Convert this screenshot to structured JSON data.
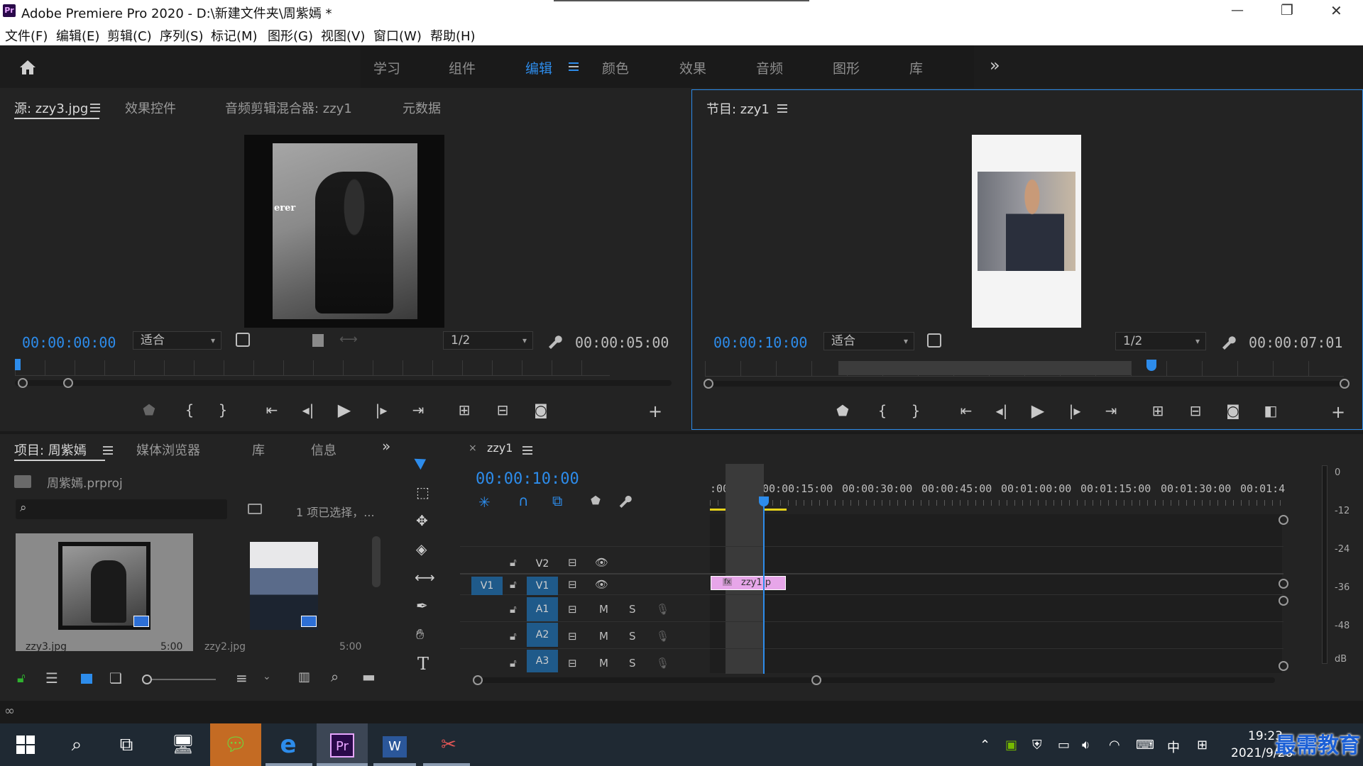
{
  "titlebar": {
    "app_icon": "Pr",
    "title": "Adobe Premiere Pro 2020 - D:\\新建文件夹\\周紫嫣 *",
    "minimize": "—",
    "maximize": "❐",
    "close": "✕"
  },
  "menu": [
    "文件(F)",
    "编辑(E)",
    "剪辑(C)",
    "序列(S)",
    "标记(M)",
    "图形(G)",
    "视图(V)",
    "窗口(W)",
    "帮助(H)"
  ],
  "workspace": {
    "tabs": [
      "学习",
      "组件",
      "编辑",
      "颜色",
      "效果",
      "音频",
      "图形",
      "库"
    ],
    "active": "编辑",
    "more": "»"
  },
  "source_panel": {
    "tabs": [
      "源: zzy3.jpg",
      "效果控件",
      "音频剪辑混合器: zzy1",
      "元数据"
    ],
    "timecode_left": "00:00:00:00",
    "fit": "适合",
    "resolution": "1/2",
    "timecode_right": "00:00:05:00",
    "image_text": "erer"
  },
  "program_panel": {
    "title": "节目: zzy1",
    "timecode_left": "00:00:10:00",
    "fit": "适合",
    "resolution": "1/2",
    "timecode_right": "00:00:07:01"
  },
  "project_panel": {
    "tabs": [
      "项目: 周紫嫣",
      "媒体浏览器",
      "库",
      "信息"
    ],
    "project_file": "周紫嫣.prproj",
    "selection_info": "1 项已选择，...",
    "items": [
      {
        "name": "zzy3.jpg",
        "duration": "5:00"
      },
      {
        "name": "zzy2.jpg",
        "duration": "5:00"
      }
    ]
  },
  "timeline": {
    "sequence": "zzy1",
    "timecode": "00:00:10:00",
    "ruler": [
      ":00:00",
      "00:00:15:00",
      "00:00:30:00",
      "00:00:45:00",
      "00:01:00:00",
      "00:01:15:00",
      "00:01:30:00",
      "00:01:4"
    ],
    "tracks": [
      {
        "label": "V2",
        "source": ""
      },
      {
        "label": "V1",
        "source": "V1"
      },
      {
        "label": "A1",
        "source": ""
      },
      {
        "label": "A2",
        "source": ""
      },
      {
        "label": "A3",
        "source": ""
      }
    ],
    "mute": "M",
    "solo": "S",
    "clip": "zzy1.p",
    "fx": "fx"
  },
  "audio_meter": {
    "labels": [
      "0",
      "-12",
      "-24",
      "-36",
      "-48",
      "dB"
    ]
  },
  "taskbar": {
    "time": "19:23",
    "date": "2021/9/26",
    "ime": "中",
    "watermark": "最需教育"
  },
  "colors": {
    "accent_blue": "#2d8ceb",
    "clip_pink": "#e7a6e9",
    "work_area_yellow": "#e6d21a"
  }
}
